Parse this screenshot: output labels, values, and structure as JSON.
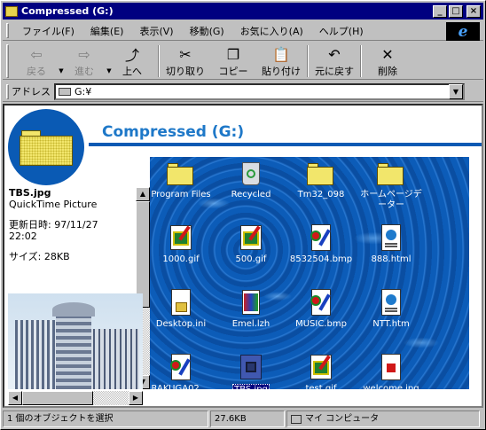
{
  "window": {
    "title": "Compressed (G:)",
    "controls": {
      "minimize": "_",
      "maximize": "□",
      "close": "×"
    }
  },
  "menu": [
    "ファイル(F)",
    "編集(E)",
    "表示(V)",
    "移動(G)",
    "お気に入り(A)",
    "ヘルプ(H)"
  ],
  "ie_logo": "e",
  "toolbar": {
    "back": "戻る",
    "forward": "進む",
    "up": "上へ",
    "cut": "切り取り",
    "copy": "コピー",
    "paste": "貼り付け",
    "undo": "元に戻す",
    "delete": "削除"
  },
  "address": {
    "label": "アドレス",
    "value": "G:¥"
  },
  "sidebar": {
    "heading": "Compressed (G:)",
    "file_name": "TBS.jpg",
    "file_type": "QuickTime Picture",
    "modified_label": "更新日時:",
    "modified_date": "97/11/27",
    "modified_time": "22:02",
    "size_label": "サイズ:",
    "size_value": "28KB"
  },
  "files": [
    {
      "name": "Program Files",
      "kind": "folder"
    },
    {
      "name": "Recycled",
      "kind": "bin"
    },
    {
      "name": "Tm32_098",
      "kind": "folder"
    },
    {
      "name": "ホームページデーター",
      "kind": "folder"
    },
    {
      "name": "1000.gif",
      "kind": "img"
    },
    {
      "name": "500.gif",
      "kind": "img"
    },
    {
      "name": "8532504.bmp",
      "kind": "bmp"
    },
    {
      "name": "888.html",
      "kind": "doc"
    },
    {
      "name": "Desktop.ini",
      "kind": "cfg"
    },
    {
      "name": "Emel.lzh",
      "kind": "lzh"
    },
    {
      "name": "MUSIC.bmp",
      "kind": "bmp"
    },
    {
      "name": "NTT.htm",
      "kind": "doc"
    },
    {
      "name": "RAKUGA02....",
      "kind": "bmp"
    },
    {
      "name": "TBS.jpg",
      "kind": "tbs",
      "selected": true
    },
    {
      "name": "test.gif",
      "kind": "img"
    },
    {
      "name": "welcome.jpg",
      "kind": "red"
    }
  ],
  "status": {
    "selection": "1 個のオブジェクトを選択",
    "size": "27.6KB",
    "zone": "マイ コンピュータ"
  }
}
